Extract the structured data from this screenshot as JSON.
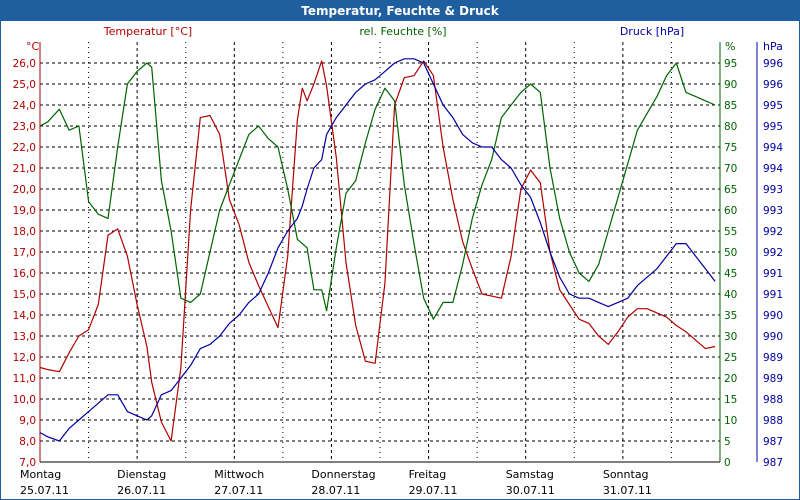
{
  "window": {
    "title": "Temperatur, Feuchte & Druck"
  },
  "colors": {
    "temperature": "#b00000",
    "humidity": "#006400",
    "pressure": "#0000a0",
    "grid": "#000000",
    "title_bg": "#1f5fa0"
  },
  "chart_data": {
    "type": "line",
    "title": "Temperatur, Feuchte & Druck",
    "grid": true,
    "x_days": [
      {
        "day": "Montag",
        "date": "25.07.11"
      },
      {
        "day": "Dienstag",
        "date": "26.07.11"
      },
      {
        "day": "Mittwoch",
        "date": "27.07.11"
      },
      {
        "day": "Donnerstag",
        "date": "28.07.11"
      },
      {
        "day": "Freitag",
        "date": "29.07.11"
      },
      {
        "day": "Samstag",
        "date": "30.07.11"
      },
      {
        "day": "Sonntag",
        "date": "31.07.11"
      }
    ],
    "axes": {
      "temperature": {
        "label": "Temperatur [°C]",
        "unit": "°C",
        "ylim": [
          7,
          27
        ],
        "ticks": [
          "7,0",
          "8,0",
          "9,0",
          "10,0",
          "11,0",
          "12,0",
          "13,0",
          "14,0",
          "15,0",
          "16,0",
          "17,0",
          "18,0",
          "19,0",
          "20,0",
          "21,0",
          "22,0",
          "23,0",
          "24,0",
          "25,0",
          "26,0"
        ]
      },
      "humidity": {
        "label": "rel. Feuchte [%]",
        "unit": "%",
        "ylim": [
          0,
          100
        ],
        "ticks": [
          "0",
          "5",
          "10",
          "15",
          "20",
          "25",
          "30",
          "35",
          "40",
          "45",
          "50",
          "55",
          "60",
          "65",
          "70",
          "75",
          "80",
          "85",
          "90",
          "95"
        ]
      },
      "pressure": {
        "label": "Druck [hPa]",
        "unit": "hPa",
        "ticks": [
          "987",
          "987",
          "988",
          "988",
          "989",
          "989",
          "990",
          "990",
          "991",
          "991",
          "992",
          "992",
          "993",
          "993",
          "994",
          "994",
          "995",
          "995",
          "996",
          "996"
        ]
      }
    },
    "series": [
      {
        "name": "Temperatur [°C]",
        "axis": "temperature",
        "x": [
          0,
          0.08,
          0.2,
          0.3,
          0.4,
          0.5,
          0.6,
          0.7,
          0.8,
          0.9,
          1.0,
          1.1,
          1.15,
          1.25,
          1.35,
          1.45,
          1.55,
          1.65,
          1.75,
          1.85,
          1.95,
          2.05,
          2.15,
          2.25,
          2.35,
          2.45,
          2.55,
          2.65,
          2.7,
          2.75,
          2.82,
          2.9,
          2.95,
          3.05,
          3.15,
          3.25,
          3.35,
          3.45,
          3.55,
          3.65,
          3.75,
          3.85,
          3.95,
          4.05,
          4.15,
          4.25,
          4.35,
          4.45,
          4.55,
          4.65,
          4.75,
          4.85,
          4.95,
          5.05,
          5.15,
          5.25,
          5.35,
          5.45,
          5.55,
          5.65,
          5.75,
          5.85,
          5.95,
          6.05,
          6.15,
          6.25,
          6.35,
          6.45,
          6.55,
          6.65,
          6.75,
          6.85,
          6.95
        ],
        "values": [
          11.5,
          11.4,
          11.3,
          12.2,
          13.0,
          13.3,
          14.5,
          17.8,
          18.1,
          16.8,
          14.5,
          12.5,
          10.8,
          8.9,
          8.0,
          11.5,
          19.0,
          23.4,
          23.5,
          22.6,
          19.5,
          18.3,
          16.5,
          15.4,
          14.4,
          13.4,
          16.8,
          23.3,
          24.8,
          24.2,
          25.0,
          26.1,
          24.9,
          21.5,
          16.5,
          13.5,
          11.8,
          11.7,
          15.5,
          24.0,
          25.3,
          25.4,
          26.1,
          25.4,
          22.0,
          19.5,
          17.5,
          16.2,
          15.0,
          14.9,
          14.8,
          16.8,
          20.0,
          20.9,
          20.3,
          17.0,
          15.2,
          14.5,
          13.8,
          13.6,
          13.0,
          12.6,
          13.2,
          13.9,
          14.3,
          14.3,
          14.1,
          13.9,
          13.5,
          13.2,
          12.8,
          12.4,
          12.5
        ]
      },
      {
        "name": "rel. Feuchte [%]",
        "axis": "humidity",
        "x": [
          0,
          0.08,
          0.2,
          0.3,
          0.4,
          0.5,
          0.6,
          0.7,
          0.8,
          0.9,
          1.0,
          1.1,
          1.15,
          1.25,
          1.35,
          1.45,
          1.55,
          1.65,
          1.75,
          1.85,
          1.95,
          2.05,
          2.15,
          2.25,
          2.35,
          2.45,
          2.55,
          2.65,
          2.7,
          2.75,
          2.82,
          2.9,
          2.95,
          3.05,
          3.15,
          3.25,
          3.35,
          3.45,
          3.55,
          3.65,
          3.75,
          3.85,
          3.95,
          4.05,
          4.15,
          4.25,
          4.35,
          4.45,
          4.55,
          4.65,
          4.75,
          4.85,
          4.95,
          5.05,
          5.15,
          5.25,
          5.35,
          5.45,
          5.55,
          5.65,
          5.75,
          5.85,
          5.95,
          6.05,
          6.15,
          6.25,
          6.35,
          6.45,
          6.55,
          6.65,
          6.75,
          6.85,
          6.95
        ],
        "values": [
          80,
          81,
          84,
          79,
          80,
          62,
          59,
          58,
          75,
          90,
          93,
          95,
          94,
          67,
          55,
          39,
          38,
          40,
          50,
          60,
          66,
          72,
          78,
          80,
          77,
          75,
          65,
          53,
          52,
          51,
          41,
          41,
          36,
          51,
          64,
          67,
          76,
          84,
          89,
          86,
          66,
          52,
          39,
          34,
          38,
          38,
          47,
          58,
          66,
          72,
          82,
          85,
          88,
          90,
          88,
          70,
          58,
          50,
          45,
          43,
          47,
          55,
          63,
          71,
          79,
          83,
          87,
          92,
          95,
          88,
          87,
          86,
          85
        ]
      },
      {
        "name": "Druck [hPa]",
        "axis": "pressure",
        "x": [
          0,
          0.08,
          0.2,
          0.3,
          0.4,
          0.5,
          0.6,
          0.7,
          0.8,
          0.9,
          1.0,
          1.1,
          1.15,
          1.25,
          1.35,
          1.45,
          1.55,
          1.65,
          1.75,
          1.85,
          1.95,
          2.05,
          2.15,
          2.25,
          2.35,
          2.45,
          2.55,
          2.65,
          2.7,
          2.75,
          2.82,
          2.9,
          2.95,
          3.05,
          3.15,
          3.25,
          3.35,
          3.45,
          3.55,
          3.65,
          3.75,
          3.85,
          3.95,
          4.05,
          4.15,
          4.25,
          4.35,
          4.45,
          4.55,
          4.65,
          4.75,
          4.85,
          4.95,
          5.05,
          5.15,
          5.25,
          5.35,
          5.45,
          5.55,
          5.65,
          5.75,
          5.85,
          5.95,
          6.05,
          6.15,
          6.25,
          6.35,
          6.45,
          6.55,
          6.65,
          6.75,
          6.85,
          6.95
        ],
        "values": [
          7,
          6,
          5,
          8,
          10,
          12,
          14,
          16,
          16,
          12,
          11,
          10,
          11,
          16,
          17,
          20,
          23,
          27,
          28,
          30,
          33,
          35,
          38,
          40,
          45,
          51,
          55,
          58,
          61,
          65,
          70,
          72,
          78,
          82,
          85,
          88,
          90,
          91,
          93,
          95,
          96,
          96,
          95,
          90,
          85,
          82,
          78,
          76,
          75,
          75,
          72,
          70,
          66,
          63,
          57,
          50,
          44,
          40,
          39,
          39,
          38,
          37,
          38,
          39,
          42,
          44,
          46,
          49,
          52,
          52,
          49,
          46,
          43
        ]
      }
    ]
  }
}
